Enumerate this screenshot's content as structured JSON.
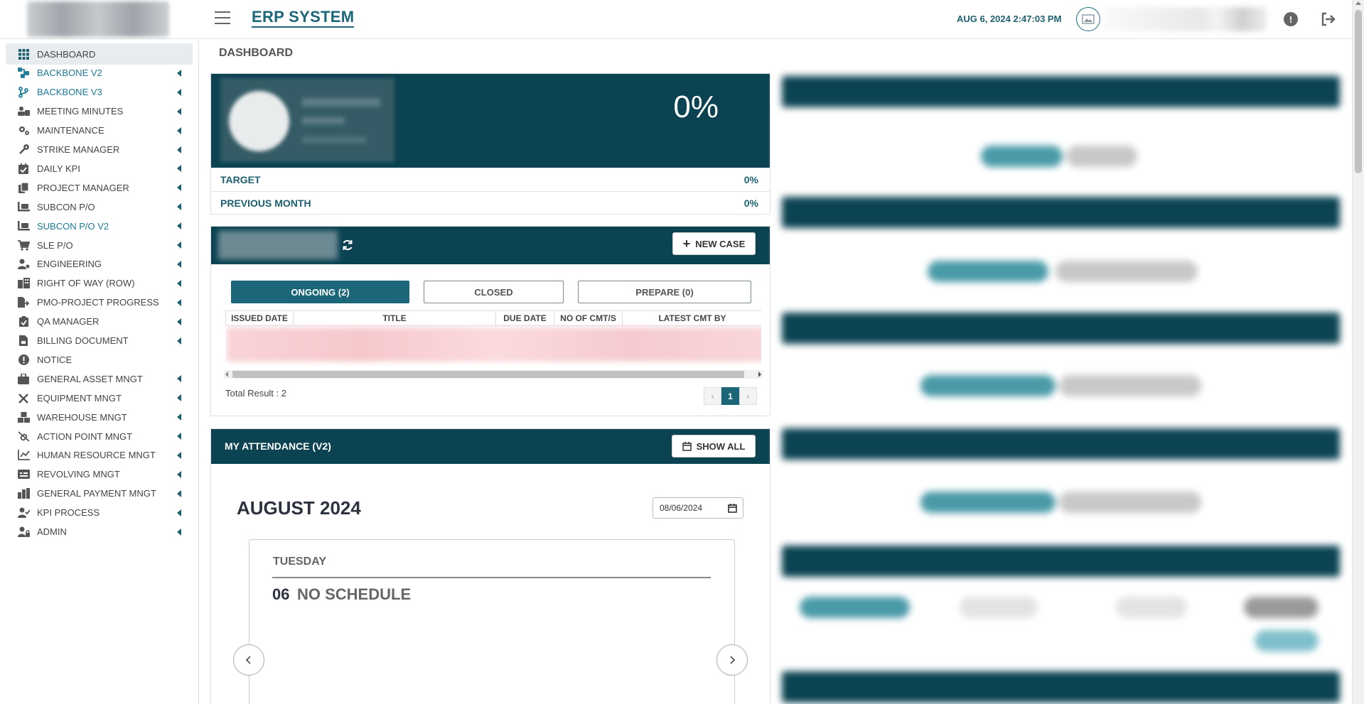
{
  "header": {
    "app_title": "ERP SYSTEM",
    "datetime": "AUG 6, 2024 2:47:03 PM"
  },
  "sidebar": {
    "items": [
      {
        "label": "DASHBOARD",
        "icon": "grid-icon"
      },
      {
        "label": "BACKBONE V2",
        "icon": "network-icon"
      },
      {
        "label": "BACKBONE V3",
        "icon": "branch-icon"
      },
      {
        "label": "MEETING MINUTES",
        "icon": "people-icon"
      },
      {
        "label": "MAINTENANCE",
        "icon": "gears-icon"
      },
      {
        "label": "STRIKE MANAGER",
        "icon": "wrench-icon"
      },
      {
        "label": "DAILY KPI",
        "icon": "calendar-check-icon"
      },
      {
        "label": "PROJECT MANAGER",
        "icon": "copy-icon"
      },
      {
        "label": "SUBCON P/O",
        "icon": "pallet-icon"
      },
      {
        "label": "SUBCON P/O V2",
        "icon": "pallet-icon"
      },
      {
        "label": "SLE P/O",
        "icon": "cart-icon"
      },
      {
        "label": "ENGINEERING",
        "icon": "user-gear-icon"
      },
      {
        "label": "RIGHT OF WAY (ROW)",
        "icon": "building-icon"
      },
      {
        "label": "PMO-PROJECT PROGRESS",
        "icon": "file-arrow-icon"
      },
      {
        "label": "QA MANAGER",
        "icon": "clipboard-check-icon"
      },
      {
        "label": "BILLING DOCUMENT",
        "icon": "file-invoice-icon"
      },
      {
        "label": "NOTICE",
        "icon": "exclamation-icon"
      },
      {
        "label": "GENERAL ASSET MNGT",
        "icon": "briefcase-icon"
      },
      {
        "label": "EQUIPMENT MNGT",
        "icon": "tools-icon"
      },
      {
        "label": "WAREHOUSE MNGT",
        "icon": "boxes-icon"
      },
      {
        "label": "ACTION POINT MNGT",
        "icon": "link-slash-icon"
      },
      {
        "label": "HUMAN RESOURCE MNGT",
        "icon": "chart-line-icon"
      },
      {
        "label": "REVOLVING MNGT",
        "icon": "money-card-icon"
      },
      {
        "label": "GENERAL PAYMENT MNGT",
        "icon": "money-check-icon"
      },
      {
        "label": "KPI PROCESS",
        "icon": "user-check-icon"
      },
      {
        "label": "ADMIN",
        "icon": "user-lock-icon"
      }
    ]
  },
  "main": {
    "page_title": "DASHBOARD",
    "kpi": {
      "percent": "0%",
      "rows": [
        {
          "label": "TARGET",
          "value": "0%"
        },
        {
          "label": "PREVIOUS MONTH",
          "value": "0%"
        }
      ]
    },
    "cases": {
      "new_case_label": "NEW CASE",
      "tabs": [
        "ONGOING (2)",
        "CLOSED",
        "PREPARE (0)"
      ],
      "columns": [
        "ISSUED DATE",
        "TITLE",
        "DUE DATE",
        "NO OF CMT/S",
        "LATEST CMT BY"
      ],
      "total": "Total Result : 2",
      "page": "1"
    },
    "attendance": {
      "title": "MY ATTENDANCE (V2)",
      "show_all_label": "SHOW ALL",
      "month": "AUGUST 2024",
      "date_value": "08/06/2024",
      "day_name": "TUESDAY",
      "day_number": "06",
      "schedule": "NO SCHEDULE"
    }
  },
  "colors": {
    "primary_dark": "#0b4352",
    "accent_teal": "#1b6679"
  }
}
